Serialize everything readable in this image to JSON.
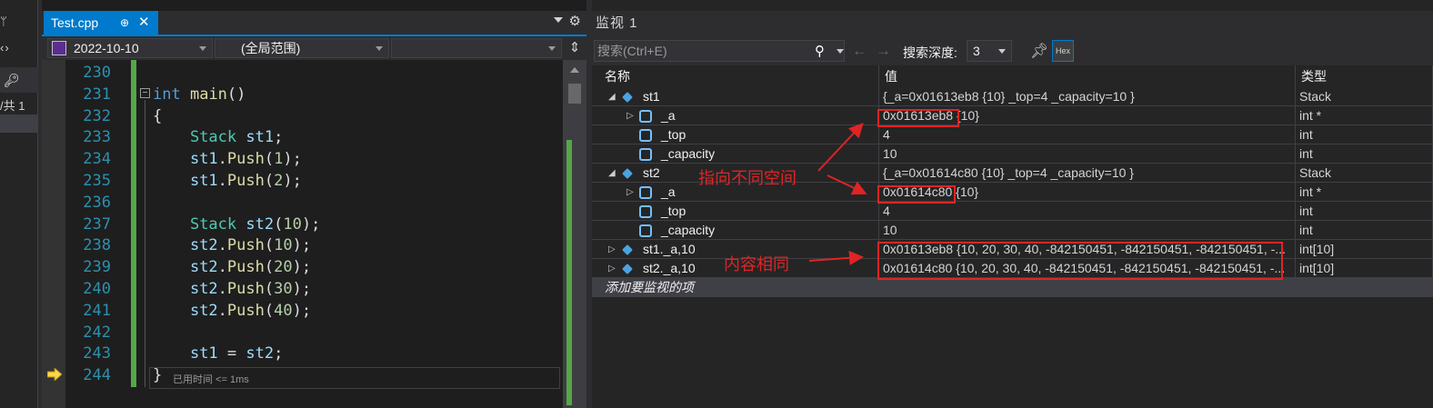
{
  "left_strip": {
    "pin": "ᛘ",
    "arrows": "‹›",
    "count": "/共 1"
  },
  "editor": {
    "tab_label": "Test.cpp",
    "tab_pin": "⊕",
    "tab_close": "✕",
    "nav": {
      "project": "2022-10-10",
      "scope": "(全局范围)",
      "member": ""
    },
    "lines": [
      {
        "n": "230",
        "code": ""
      },
      {
        "n": "231",
        "code": "int main()"
      },
      {
        "n": "232",
        "code": "{"
      },
      {
        "n": "233",
        "code": "    Stack st1;"
      },
      {
        "n": "234",
        "code": "    st1.Push(1);"
      },
      {
        "n": "235",
        "code": "    st1.Push(2);"
      },
      {
        "n": "236",
        "code": ""
      },
      {
        "n": "237",
        "code": "    Stack st2(10);"
      },
      {
        "n": "238",
        "code": "    st2.Push(10);"
      },
      {
        "n": "239",
        "code": "    st2.Push(20);"
      },
      {
        "n": "240",
        "code": "    st2.Push(30);"
      },
      {
        "n": "241",
        "code": "    st2.Push(40);"
      },
      {
        "n": "242",
        "code": ""
      },
      {
        "n": "243",
        "code": "    st1 = st2;"
      },
      {
        "n": "244",
        "code": "}"
      }
    ],
    "elapsed": "已用时间 <= 1ms"
  },
  "watch": {
    "title": "监视 1",
    "search_placeholder": "搜索(Ctrl+E)",
    "depth_label": "搜索深度:",
    "depth_value": "3",
    "hex_label": "Hex",
    "columns": {
      "name": "名称",
      "value": "值",
      "type": "类型"
    },
    "rows": [
      {
        "name": "st1",
        "value": "{_a=0x01613eb8 {10} _top=4 _capacity=10 }",
        "type": "Stack"
      },
      {
        "name": "_a",
        "value": "0x01613eb8 {10}",
        "type": "int *"
      },
      {
        "name": "_top",
        "value": "4",
        "type": "int"
      },
      {
        "name": "_capacity",
        "value": "10",
        "type": "int"
      },
      {
        "name": "st2",
        "value": "{_a=0x01614c80 {10} _top=4 _capacity=10 }",
        "type": "Stack"
      },
      {
        "name": "_a",
        "value": "0x01614c80 {10}",
        "type": "int *"
      },
      {
        "name": "_top",
        "value": "4",
        "type": "int"
      },
      {
        "name": "_capacity",
        "value": "10",
        "type": "int"
      },
      {
        "name": "st1._a,10",
        "value": "0x01613eb8 {10, 20, 30, 40, -842150451, -842150451, -842150451, -...",
        "type": "int[10]"
      },
      {
        "name": "st2._a,10",
        "value": "0x01614c80 {10, 20, 30, 40, -842150451, -842150451, -842150451, -...",
        "type": "int[10]"
      }
    ],
    "add_item": "添加要监视的项"
  },
  "annotations": {
    "different_space": "指向不同空间",
    "same_content": "内容相同",
    "color": "#e02424"
  }
}
